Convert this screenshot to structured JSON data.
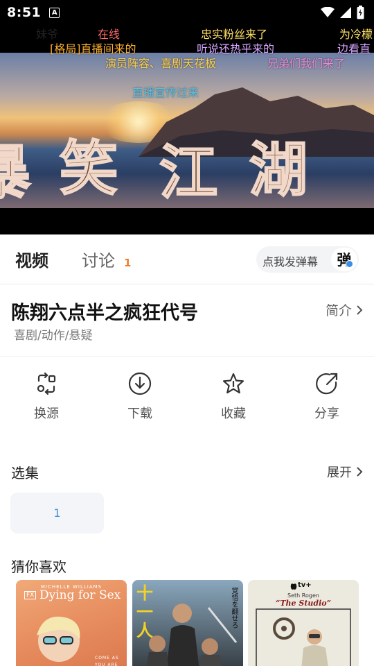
{
  "status_bar": {
    "time": "8:51",
    "notification_glyph": "A"
  },
  "player": {
    "danmaku": [
      {
        "text": "妹爷",
        "color": "#ffffff"
      },
      {
        "text": "在线",
        "color": "#ff6b6b"
      },
      {
        "text": "忠实粉丝来了",
        "color": "#ffe066"
      },
      {
        "text": "为冷檬",
        "color": "#ffe066"
      },
      {
        "text": "[格局]直播间来的",
        "color": "#ffb02e"
      },
      {
        "text": "听说还热乎来的",
        "color": "#d7a6ff"
      },
      {
        "text": "边看直",
        "color": "#d7a6ff"
      },
      {
        "text": "演员阵容、喜剧天花板",
        "color": "#ffd24a"
      },
      {
        "text": "兄弟们我们来了",
        "color": "#e98bd6"
      },
      {
        "text": "直播宣传过来",
        "color": "#56c2e6"
      }
    ],
    "title_art": "暴笑江湖"
  },
  "tabs": {
    "video_label": "视频",
    "discuss_label": "讨论",
    "discuss_count": "1",
    "danmaku_button_label": "点我发弹幕",
    "danmaku_toggle_label": "弹"
  },
  "show": {
    "title": "陈翔六点半之疯狂代号",
    "genre": "喜剧/动作/悬疑",
    "intro_label": "简介"
  },
  "actions": [
    {
      "label": "换源",
      "icon": "switch-source-icon"
    },
    {
      "label": "下载",
      "icon": "download-icon"
    },
    {
      "label": "收藏",
      "icon": "star-icon"
    },
    {
      "label": "分享",
      "icon": "share-icon"
    }
  ],
  "episodes": {
    "title": "选集",
    "expand_label": "展开",
    "items": [
      "1"
    ]
  },
  "recommend": {
    "title": "猜你喜欢",
    "posters": [
      {
        "top_text": "MICHELLE WILLIAMS",
        "brand": "FX",
        "title": "Dying for Sex",
        "tagline": "COME AS YOU ARE"
      },
      {
        "title": "十一人",
        "side_text": "覚悟を翻せろ"
      },
      {
        "brand": "tv+",
        "credit": "Seth Rogen",
        "title": "“The Studio”"
      }
    ]
  },
  "colors": {
    "accent": "#f07c2b",
    "link_blue": "#4a90d9"
  }
}
